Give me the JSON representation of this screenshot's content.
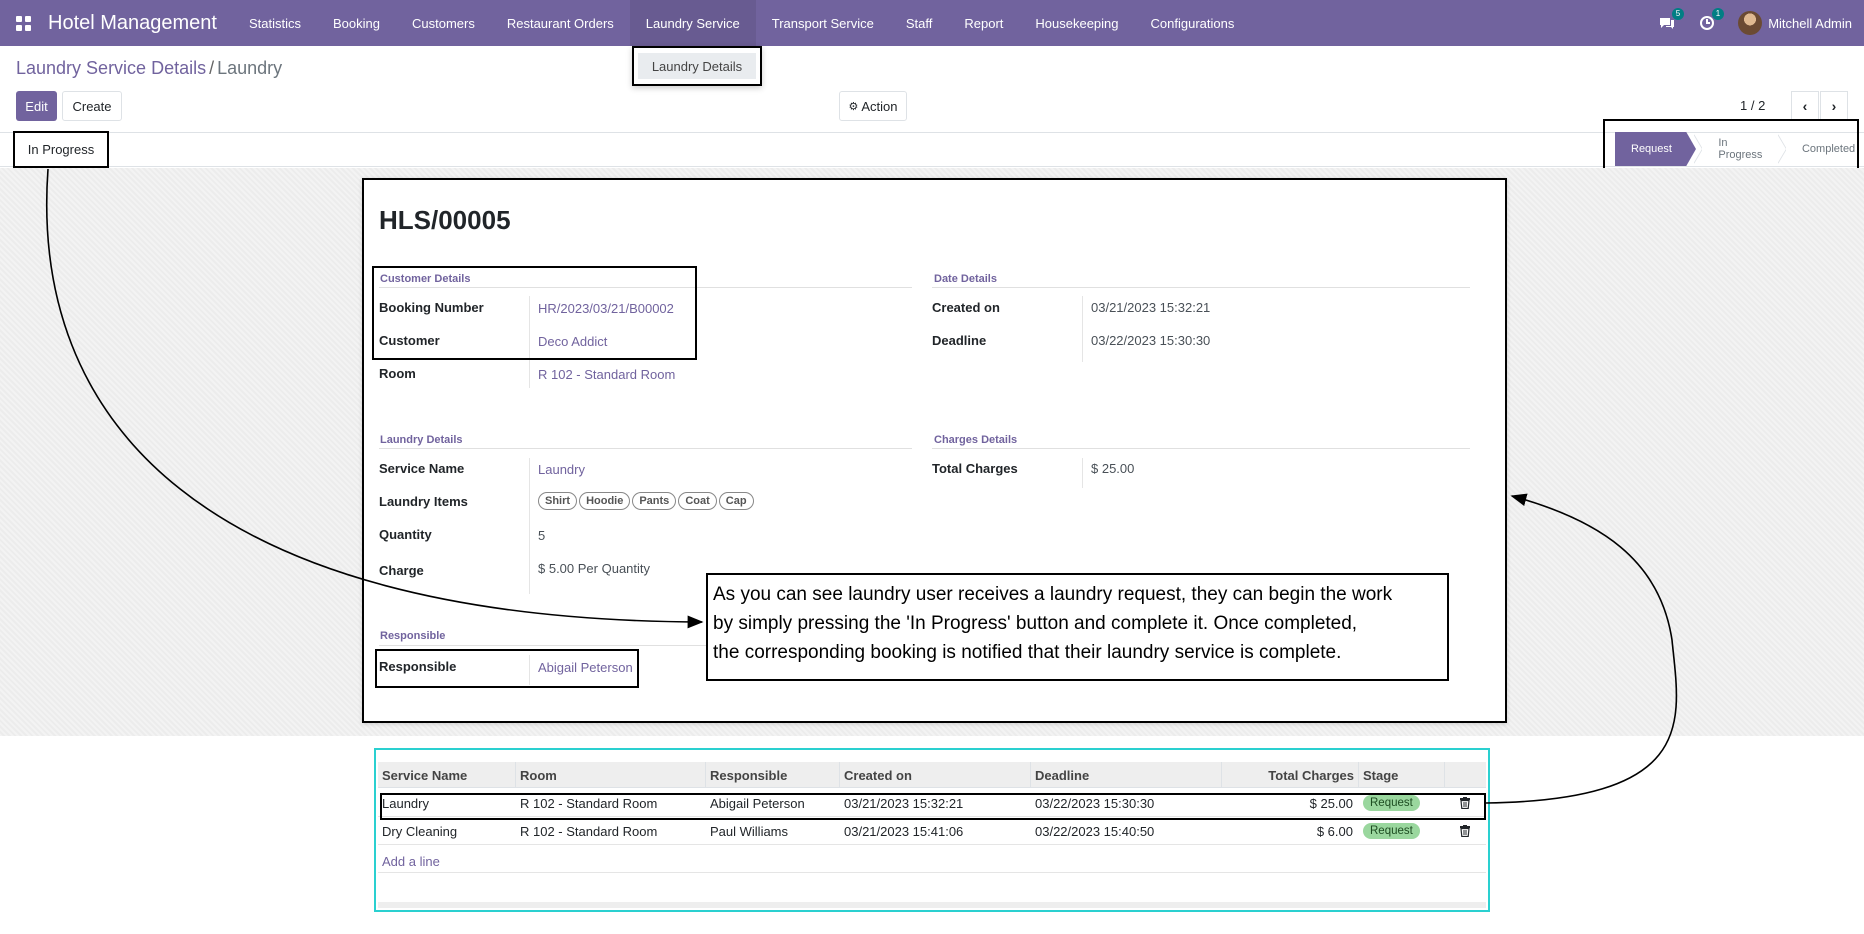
{
  "navbar": {
    "brand": "Hotel Management",
    "menu": [
      "Statistics",
      "Booking",
      "Customers",
      "Restaurant Orders",
      "Laundry Service",
      "Transport Service",
      "Staff",
      "Report",
      "Housekeeping",
      "Configurations"
    ],
    "messages_count": "5",
    "activities_count": "1",
    "user_name": "Mitchell Admin",
    "accent_color": "#71639e"
  },
  "dropdown": {
    "item": "Laundry Details"
  },
  "breadcrumb": {
    "parent": "Laundry Service Details",
    "separator": "/",
    "current": "Laundry"
  },
  "toolbar": {
    "edit": "Edit",
    "create": "Create",
    "action": "Action"
  },
  "pager": {
    "text": "1 / 2"
  },
  "statusbar": {
    "in_progress_button": "In Progress",
    "stages": [
      "Request",
      "In Progress",
      "Completed"
    ],
    "active_stage": "Request"
  },
  "form": {
    "record_name": "HLS/00005",
    "customer_details": {
      "title": "Customer Details",
      "booking_number_label": "Booking Number",
      "booking_number": "HR/2023/03/21/B00002",
      "customer_label": "Customer",
      "customer": "Deco Addict",
      "room_label": "Room",
      "room": "R 102 - Standard Room"
    },
    "date_details": {
      "title": "Date Details",
      "created_on_label": "Created on",
      "created_on": "03/21/2023 15:32:21",
      "deadline_label": "Deadline",
      "deadline": "03/22/2023 15:30:30"
    },
    "laundry_details": {
      "title": "Laundry Details",
      "service_name_label": "Service Name",
      "service_name": "Laundry",
      "items_label": "Laundry Items",
      "items": [
        "Shirt",
        "Hoodie",
        "Pants",
        "Coat",
        "Cap"
      ],
      "quantity_label": "Quantity",
      "quantity": "5",
      "charge_label": "Charge",
      "charge": "$ 5.00 Per Quantity"
    },
    "charges_details": {
      "title": "Charges Details",
      "total_charges_label": "Total Charges",
      "total_charges": "$ 25.00"
    },
    "responsible": {
      "title": "Responsible",
      "label": "Responsible",
      "value": "Abigail Peterson"
    }
  },
  "note": {
    "line1": "As you can see laundry user receives a laundry request, they can begin the work",
    "line2": "by simply pressing the 'In Progress' button and complete it. Once completed,",
    "line3": "the corresponding booking is notified that their laundry service is complete."
  },
  "table": {
    "headers": [
      "Service Name",
      "Room",
      "Responsible",
      "Created on",
      "Deadline",
      "Total Charges",
      "Stage"
    ],
    "rows": [
      {
        "service": "Laundry",
        "room": "R 102 - Standard Room",
        "responsible": "Abigail Peterson",
        "created": "03/21/2023 15:32:21",
        "deadline": "03/22/2023 15:30:30",
        "total": "$ 25.00",
        "stage": "Request"
      },
      {
        "service": "Dry Cleaning",
        "room": "R 102 - Standard Room",
        "responsible": "Paul Williams",
        "created": "03/21/2023 15:41:06",
        "deadline": "03/22/2023 15:40:50",
        "total": "$ 6.00",
        "stage": "Request"
      }
    ],
    "add_line": "Add a line"
  }
}
